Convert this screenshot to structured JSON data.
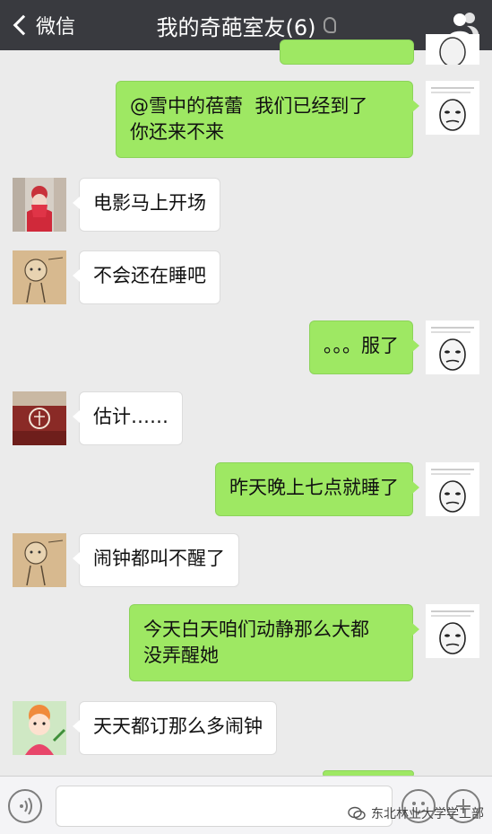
{
  "header": {
    "back_label": "微信",
    "title": "我的奇葩室友(6)"
  },
  "messages": [
    {
      "side": "right",
      "text": "@雪中的蓓蕾  我们已经到了\n你还来不来",
      "avatar": "meme-face-avatar"
    },
    {
      "side": "left",
      "text": "电影马上开场",
      "avatar": "girl-red-scarf-avatar"
    },
    {
      "side": "left",
      "text": "不会还在睡吧",
      "avatar": "cartoon-sketch-avatar"
    },
    {
      "side": "right",
      "text": "。。。服了",
      "avatar": "meme-face-avatar"
    },
    {
      "side": "left",
      "text": "估计……",
      "avatar": "red-stamp-avatar"
    },
    {
      "side": "right",
      "text": "昨天晚上七点就睡了",
      "avatar": "meme-face-avatar"
    },
    {
      "side": "left",
      "text": "闹钟都叫不醒了",
      "avatar": "cartoon-sketch-avatar"
    },
    {
      "side": "right",
      "text": "今天白天咱们动静那么大都\n没弄醒她",
      "avatar": "meme-face-avatar"
    },
    {
      "side": "left",
      "text": "天天都订那么多闹钟",
      "avatar": "cartoon-girl-avatar"
    }
  ],
  "watermark": {
    "text": "东北林业大学学工部"
  },
  "colors": {
    "header_bg": "#393a3f",
    "chat_bg": "#ebebeb",
    "sent_bubble": "#9ee863",
    "received_bubble": "#ffffff"
  }
}
